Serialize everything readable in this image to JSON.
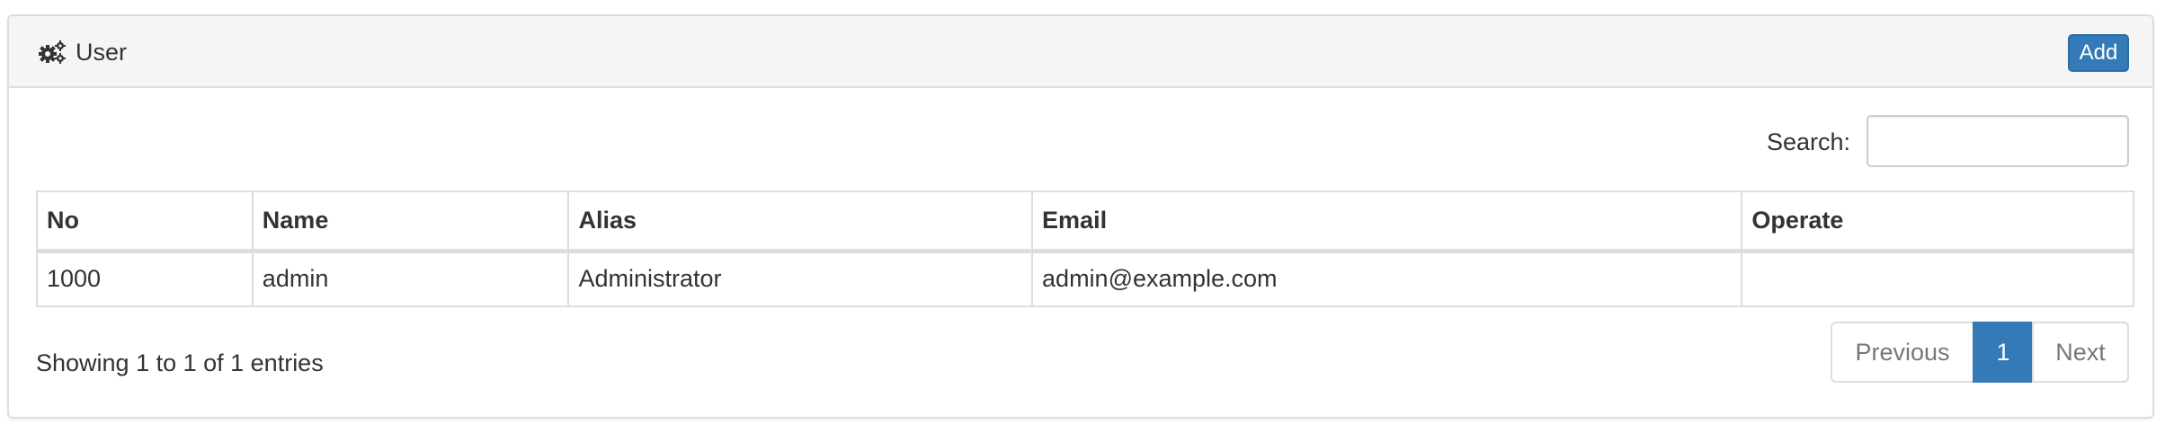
{
  "panel": {
    "title": "User",
    "add_label": "Add"
  },
  "search": {
    "label": "Search:",
    "value": ""
  },
  "table": {
    "headers": [
      "No",
      "Name",
      "Alias",
      "Email",
      "Operate"
    ],
    "rows": [
      [
        "1000",
        "admin",
        "Administrator",
        "admin@example.com",
        ""
      ]
    ]
  },
  "footer": {
    "info": "Showing 1 to 1 of 1 entries",
    "pagination": {
      "previous": "Previous",
      "current": "1",
      "next": "Next"
    }
  },
  "colors": {
    "primary": "#337ab7",
    "heading_bg": "#f5f5f5",
    "border": "#dddddd"
  },
  "icons": {
    "title_icon": "gears-icon"
  }
}
